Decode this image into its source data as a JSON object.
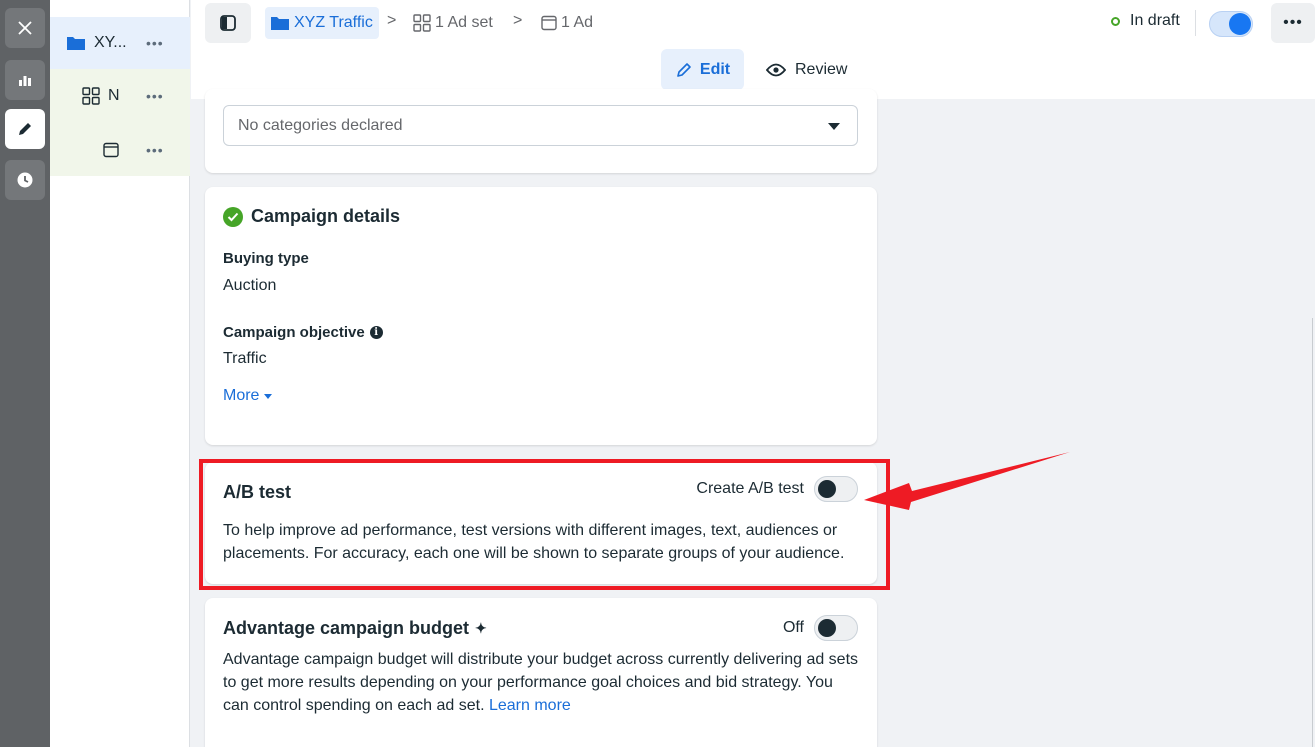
{
  "rail": {
    "buttons": [
      "close",
      "reporting",
      "edit",
      "history"
    ]
  },
  "tree": {
    "campaign_label": "XY...",
    "adset_label": "N",
    "more": "•••"
  },
  "topbar": {
    "breadcrumb": [
      {
        "label": "XYZ Traffic",
        "icon": "folder-icon"
      },
      {
        "label": "1 Ad set",
        "icon": "adset-grid-icon"
      },
      {
        "label": "1 Ad",
        "icon": "ad-icon"
      }
    ],
    "breadcrumb_sep": ">",
    "status": "In draft",
    "more": "•••",
    "edit_label": "Edit",
    "review_label": "Review"
  },
  "special_ad_categories": {
    "placeholder": "No categories declared"
  },
  "campaign_details": {
    "title": "Campaign details",
    "buying_type_label": "Buying type",
    "buying_type_value": "Auction",
    "objective_label": "Campaign objective",
    "objective_value": "Traffic",
    "more_label": "More"
  },
  "ab_test": {
    "title": "A/B test",
    "toggle_label": "Create A/B test",
    "toggle_on": false,
    "description": "To help improve ad performance, test versions with different images, text, audiences or placements. For accuracy, each one will be shown to separate groups of your audience."
  },
  "advantage_budget": {
    "title": "Advantage campaign budget",
    "sparkle": "✦",
    "toggle_label": "Off",
    "toggle_on": false,
    "description": "Advantage campaign budget will distribute your budget across currently delivering ad sets to get more results depending on your performance goal choices and bid strategy. You can control spending on each ad set.",
    "link_label": "Learn more"
  },
  "colors": {
    "accent": "#1877f2",
    "success": "#46a528",
    "highlight": "#ee1b24"
  }
}
